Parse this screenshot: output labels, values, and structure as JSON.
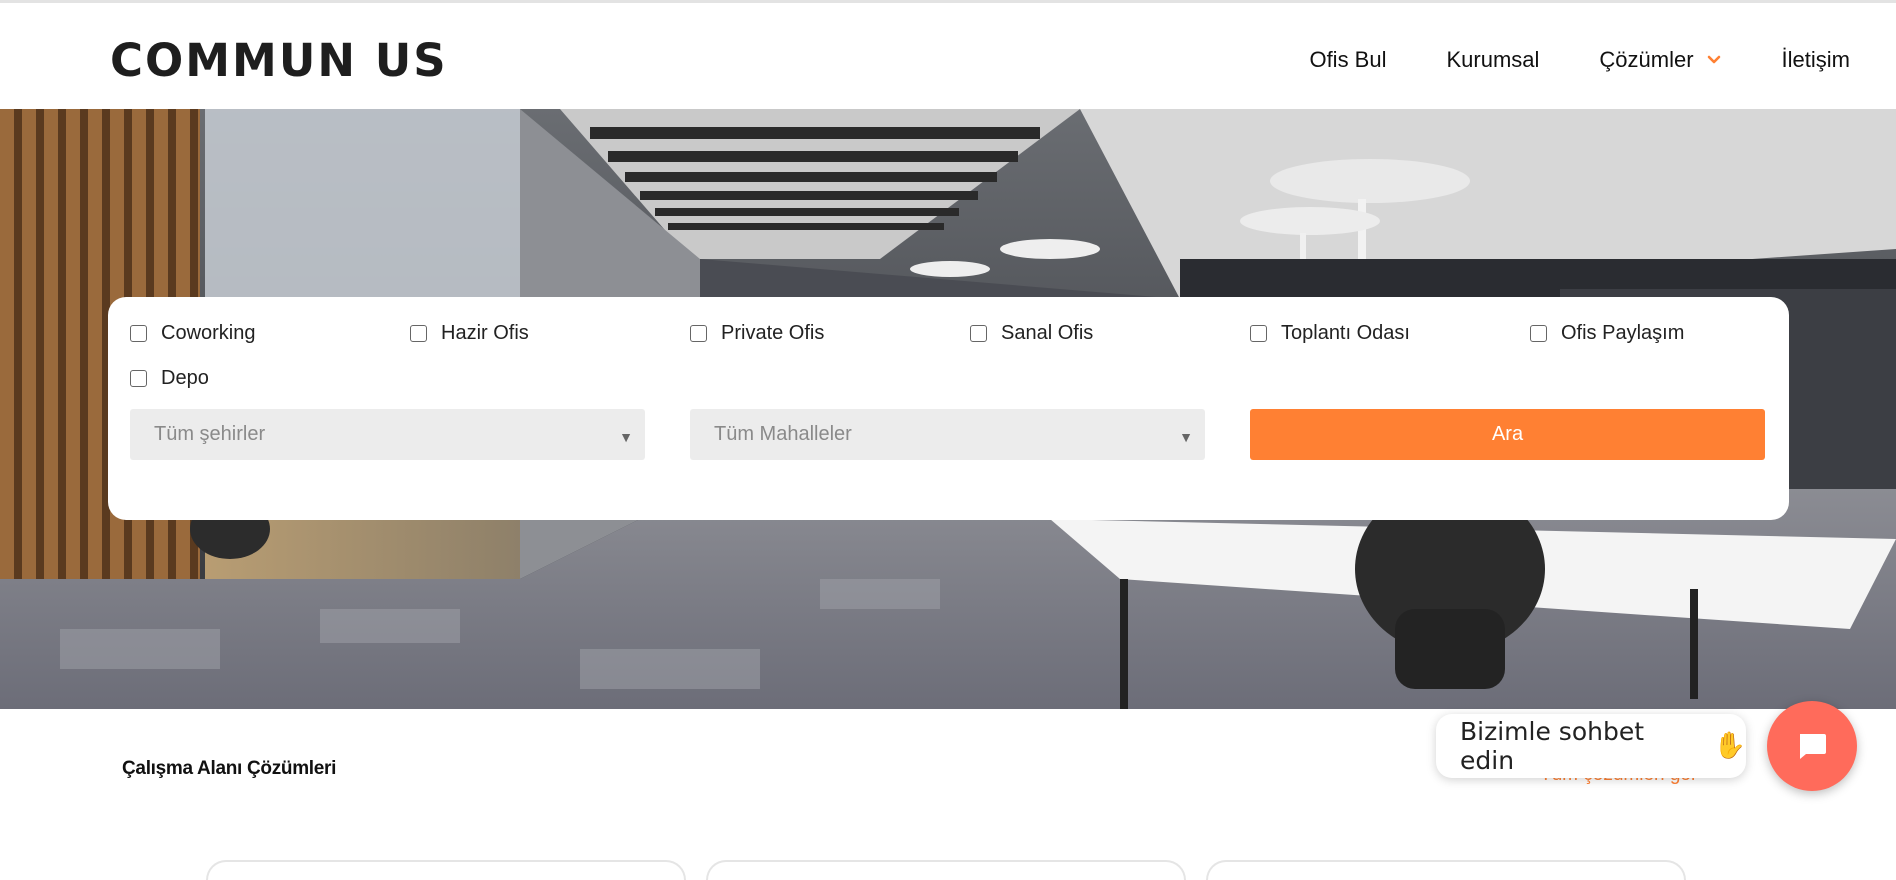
{
  "brand": {
    "logo_text": "COMMUN US"
  },
  "nav": {
    "items": [
      {
        "label": "Ofis Bul"
      },
      {
        "label": "Kurumsal"
      },
      {
        "label": "Çözümler",
        "has_dropdown": true
      },
      {
        "label": "İletişim"
      }
    ]
  },
  "search": {
    "checkboxes": [
      {
        "label": "Coworking",
        "checked": false
      },
      {
        "label": "Hazir Ofis",
        "checked": false
      },
      {
        "label": "Private Ofis",
        "checked": false
      },
      {
        "label": "Sanal Ofis",
        "checked": false
      },
      {
        "label": "Toplantı Odası",
        "checked": false
      },
      {
        "label": "Ofis Paylaşım",
        "checked": false
      },
      {
        "label": "Depo",
        "checked": false
      }
    ],
    "city_select": {
      "value": "Tüm şehirler"
    },
    "district_select": {
      "value": "Tüm Mahalleler"
    },
    "submit_label": "Ara"
  },
  "section": {
    "title": "Çalışma Alanı Çözümleri",
    "see_all": "Tüm çözümleri gör"
  },
  "chat": {
    "prompt": "Bizimle sohbet edin",
    "icon": "chat-icon"
  },
  "colors": {
    "accent": "#ff8033",
    "chat_button": "#ff6b5b",
    "select_bg": "#ececec"
  }
}
